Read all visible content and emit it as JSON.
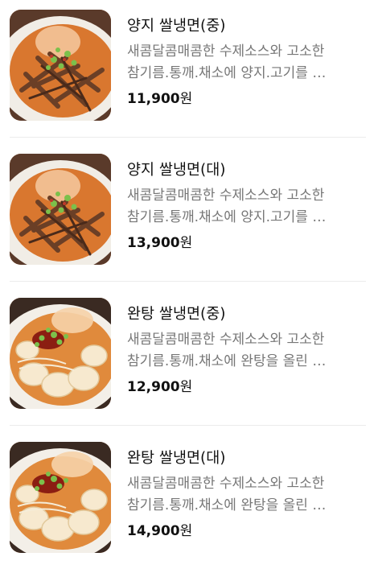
{
  "menu": {
    "items": [
      {
        "name": "양지 쌀냉면(중)",
        "description": "새콤달콤매콤한 수제소스와 고소한 참기름.통깨.채소에 양지.고기를 …",
        "price": "11,900",
        "currency": "원",
        "image_icon": "beef-cold-noodle-photo"
      },
      {
        "name": "양지 쌀냉면(대)",
        "description": "새콤달콤매콤한 수제소스와 고소한 참기름.통깨.채소에 양지.고기를 …",
        "price": "13,900",
        "currency": "원",
        "image_icon": "beef-cold-noodle-photo"
      },
      {
        "name": "완탕 쌀냉면(중)",
        "description": "새콤달콤매콤한 수제소스와 고소한 참기름.통깨.채소에 완탕을 올린 …",
        "price": "12,900",
        "currency": "원",
        "image_icon": "wonton-cold-noodle-photo"
      },
      {
        "name": "완탕 쌀냉면(대)",
        "description": "새콤달콤매콤한 수제소스와 고소한 참기름.통깨.채소에 완탕을 올린 …",
        "price": "14,900",
        "currency": "원",
        "image_icon": "wonton-cold-noodle-photo"
      }
    ]
  },
  "colors": {
    "title": "#111111",
    "description": "#777777",
    "divider": "#ececec",
    "broth": "#d9772f"
  }
}
